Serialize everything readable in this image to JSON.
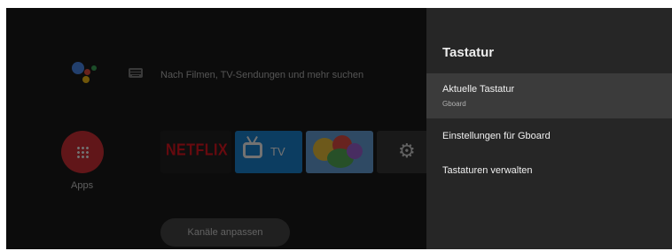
{
  "home": {
    "search_placeholder": "Nach Filmen, TV-Sendungen und mehr suchen",
    "apps_label": "Apps",
    "tiles": {
      "netflix": "NETFLIX",
      "tv": "TV"
    },
    "channels_button": "Kanäle anpassen"
  },
  "panel": {
    "title": "Tastatur",
    "items": [
      {
        "label": "Aktuelle Tastatur",
        "sublabel": "Gboard",
        "selected": true
      },
      {
        "label": "Einstellungen für Gboard"
      },
      {
        "label": "Tastaturen verwalten"
      }
    ]
  },
  "icons": {
    "assistant": "google-assistant-icon",
    "keyboard": "keyboard-icon",
    "apps": "apps-grid-icon",
    "tv": "tv-icon",
    "settings": "gear-icon"
  },
  "colors": {
    "panel_bg": "#262626",
    "selected_item_bg": "#3b3b3b",
    "apps_red": "#d6262b",
    "netflix_red": "#e50914",
    "tv_blue": "#0c82d6"
  }
}
